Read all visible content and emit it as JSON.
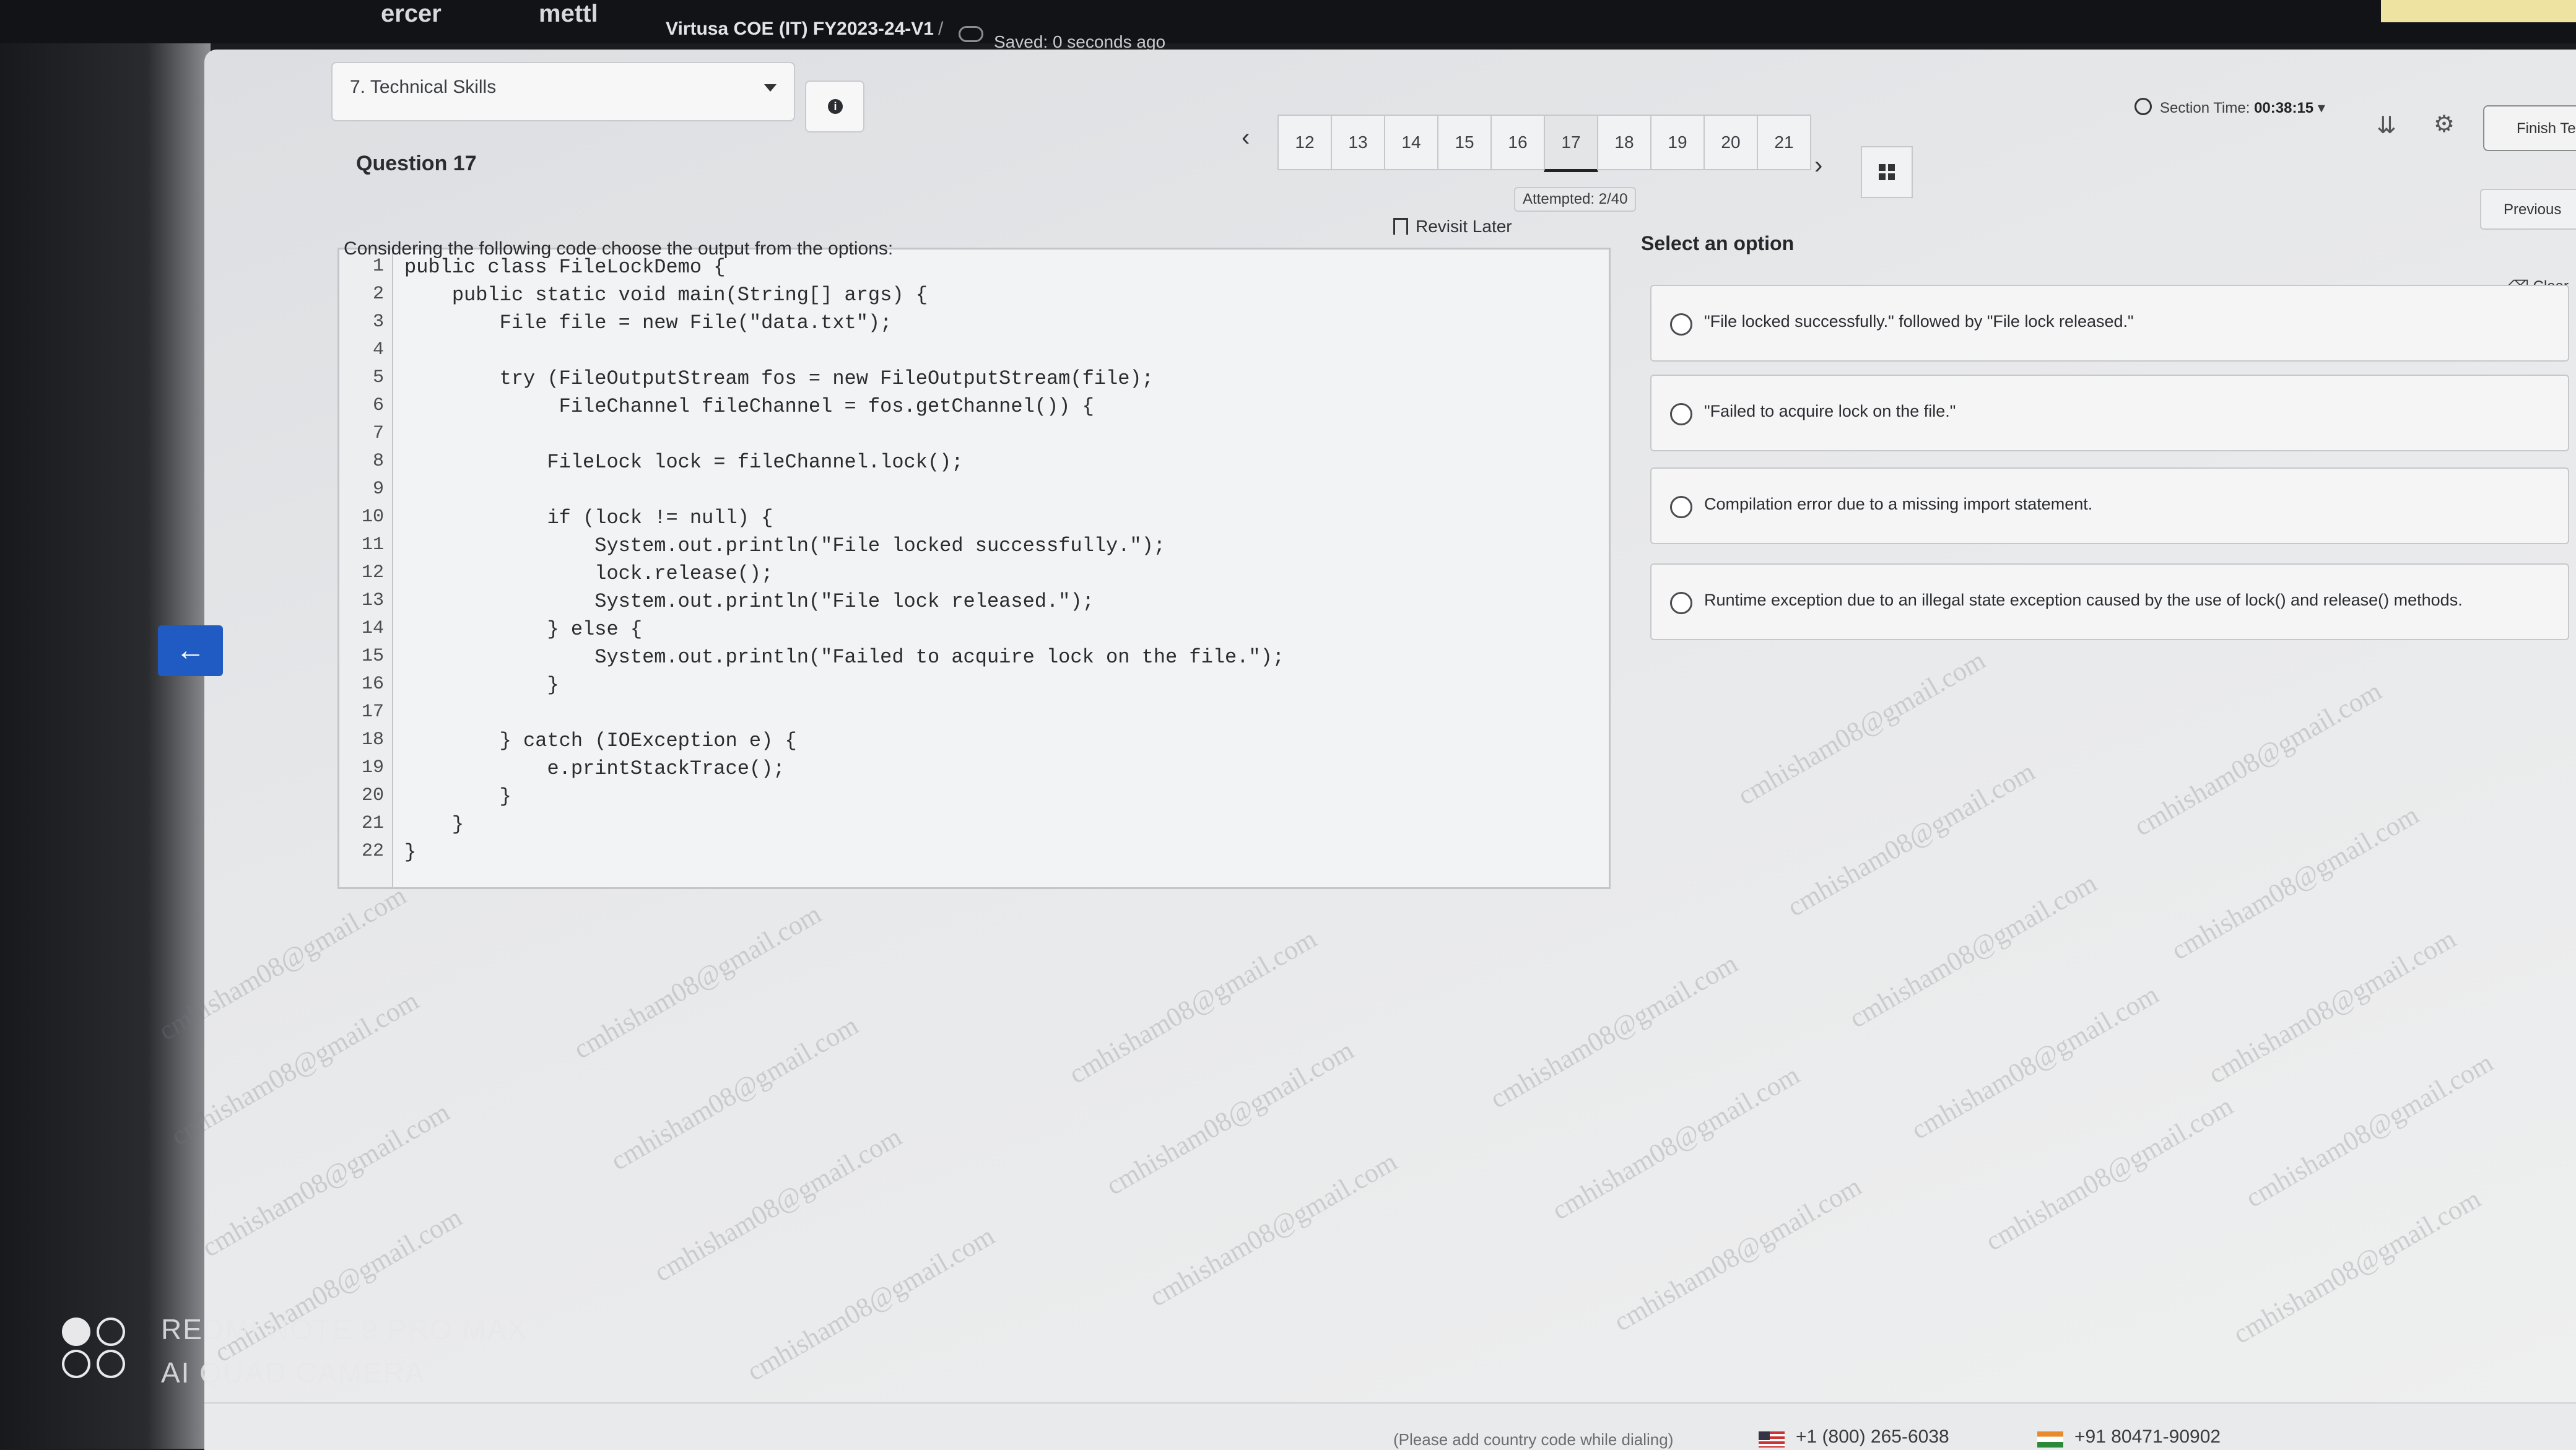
{
  "app": {
    "brand_left": "ercer",
    "brand_right": "mettl",
    "test_title": "Virtusa COE (IT) FY2023-24-V1",
    "breadcrumb_sep": "/",
    "save_status": "Saved: 0 seconds ago"
  },
  "section": {
    "selected": "7. Technical Skills",
    "time_label": "Section Time:",
    "time_value": "00:38:15",
    "finish_label": "Finish Te",
    "previous_label": "Previous",
    "clear_label": "Clear"
  },
  "pagination": {
    "pages": [
      "12",
      "13",
      "14",
      "15",
      "16",
      "17",
      "18",
      "19",
      "20",
      "21"
    ],
    "active": "17",
    "attempted": "Attempted: 2/40"
  },
  "question": {
    "title": "Question 17",
    "revisit_label": "Revisit Later",
    "prompt": "Considering the following code choose the output from the options:",
    "code_lines": [
      {
        "n": "1",
        "t": "public class FileLockDemo {"
      },
      {
        "n": "2",
        "t": "    public static void main(String[] args) {"
      },
      {
        "n": "3",
        "t": "        File file = new File(\"data.txt\");"
      },
      {
        "n": "4",
        "t": ""
      },
      {
        "n": "5",
        "t": "        try (FileOutputStream fos = new FileOutputStream(file);"
      },
      {
        "n": "6",
        "t": "             FileChannel fileChannel = fos.getChannel()) {"
      },
      {
        "n": "7",
        "t": ""
      },
      {
        "n": "8",
        "t": "            FileLock lock = fileChannel.lock();"
      },
      {
        "n": "9",
        "t": ""
      },
      {
        "n": "10",
        "t": "            if (lock != null) {"
      },
      {
        "n": "11",
        "t": "                System.out.println(\"File locked successfully.\");"
      },
      {
        "n": "12",
        "t": "                lock.release();"
      },
      {
        "n": "13",
        "t": "                System.out.println(\"File lock released.\");"
      },
      {
        "n": "14",
        "t": "            } else {"
      },
      {
        "n": "15",
        "t": "                System.out.println(\"Failed to acquire lock on the file.\");"
      },
      {
        "n": "16",
        "t": "            }"
      },
      {
        "n": "17",
        "t": ""
      },
      {
        "n": "18",
        "t": "        } catch (IOException e) {"
      },
      {
        "n": "19",
        "t": "            e.printStackTrace();"
      },
      {
        "n": "20",
        "t": "        }"
      },
      {
        "n": "21",
        "t": "    }"
      },
      {
        "n": "22",
        "t": "}"
      }
    ]
  },
  "options": {
    "label": "Select an option",
    "items": [
      "\"File locked successfully.\" followed by \"File lock released.\"",
      "\"Failed to acquire lock on the file.\"",
      "Compilation error due to a missing import statement.",
      "Runtime exception due to an illegal state exception caused by the use of lock() and release() methods."
    ]
  },
  "watermark": "cmhisham08@gmail.com",
  "footer": {
    "note": "(Please add country code while dialing)",
    "phone_us": "+1 (800) 265-6038",
    "phone_in": "+91 80471-90902"
  },
  "camera": {
    "line1": "REDMI NOTE 9 PRO MAX",
    "line2": "AI QUAD CAMERA"
  },
  "icons": {
    "info": "info-icon",
    "grid": "grid-icon",
    "back": "arrow-left-icon",
    "bookmark": "bookmark-icon",
    "clock": "clock-icon",
    "settings": "gear-icon"
  },
  "colors": {
    "accent": "#1f5bc3",
    "topbar": "#121316"
  }
}
